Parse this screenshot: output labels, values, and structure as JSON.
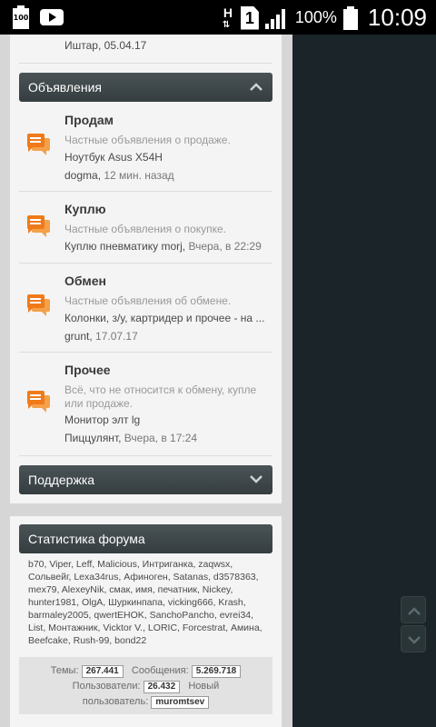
{
  "status_bar": {
    "battery_small_text": "100",
    "net_type": "H",
    "sim_slot": "1",
    "battery_pct": "100%",
    "time": "10:09"
  },
  "top_post": {
    "author": "Иштар,",
    "date": "05.04.17"
  },
  "sections": {
    "ads": {
      "header": "Объявления",
      "forums": [
        {
          "title": "Продам",
          "desc": "Частные объявления о продаже.",
          "last_topic": "Ноутбук Asus X54H",
          "last_user": "dogma,",
          "last_time": "12 мин. назад"
        },
        {
          "title": "Куплю",
          "desc": "Частные объявления о покупке.",
          "last_topic": "Куплю пневматику",
          "last_user": "morj,",
          "last_time": "Вчера, в 22:29"
        },
        {
          "title": "Обмен",
          "desc": "Частные объявления об обмене.",
          "last_topic": "Колонки, з/у, картридер и прочее - на ...",
          "last_user": "grunt,",
          "last_time": "17.07.17"
        },
        {
          "title": "Прочее",
          "desc": "Всё, что не относится к обмену, купле или продаже.",
          "last_topic": "Монитор элт lg",
          "last_user": "Пиццулянт,",
          "last_time": "Вчера, в 17:24"
        }
      ]
    },
    "support": {
      "header": "Поддержка"
    }
  },
  "stats_block": {
    "header": "Статистика форума",
    "online_users": "b70, Viper, Leff, Malicious, Интриганка, zaqwsx, Сольвейг, Lexa34rus, Афиноген, Satanas, d3578363, mex79, AlexeyNik, смак, имя, печатник, Nickey, hunter1981, OlgA, Шуркинпапа, vicking666, Krash, barmaley2005, qwertEHOK, SanchoPancho, evrei34, List, Монтажник, Vicktor V., LORIC, Forcestrat, Амина, Beefcake, Rush-99, bond22",
    "topics_label": "Темы:",
    "topics_value": "267.441",
    "posts_label": "Сообщения:",
    "posts_value": "5.269.718",
    "users_label": "Пользователи:",
    "users_value": "26.432",
    "newuser_label_1": "Новый",
    "newuser_label_2": "пользователь:",
    "newuser_value": "muromtsev"
  },
  "colors": {
    "icon_orange": "#f07a1a",
    "header_dark": "#3d4548",
    "page_dark": "#1b2428"
  }
}
